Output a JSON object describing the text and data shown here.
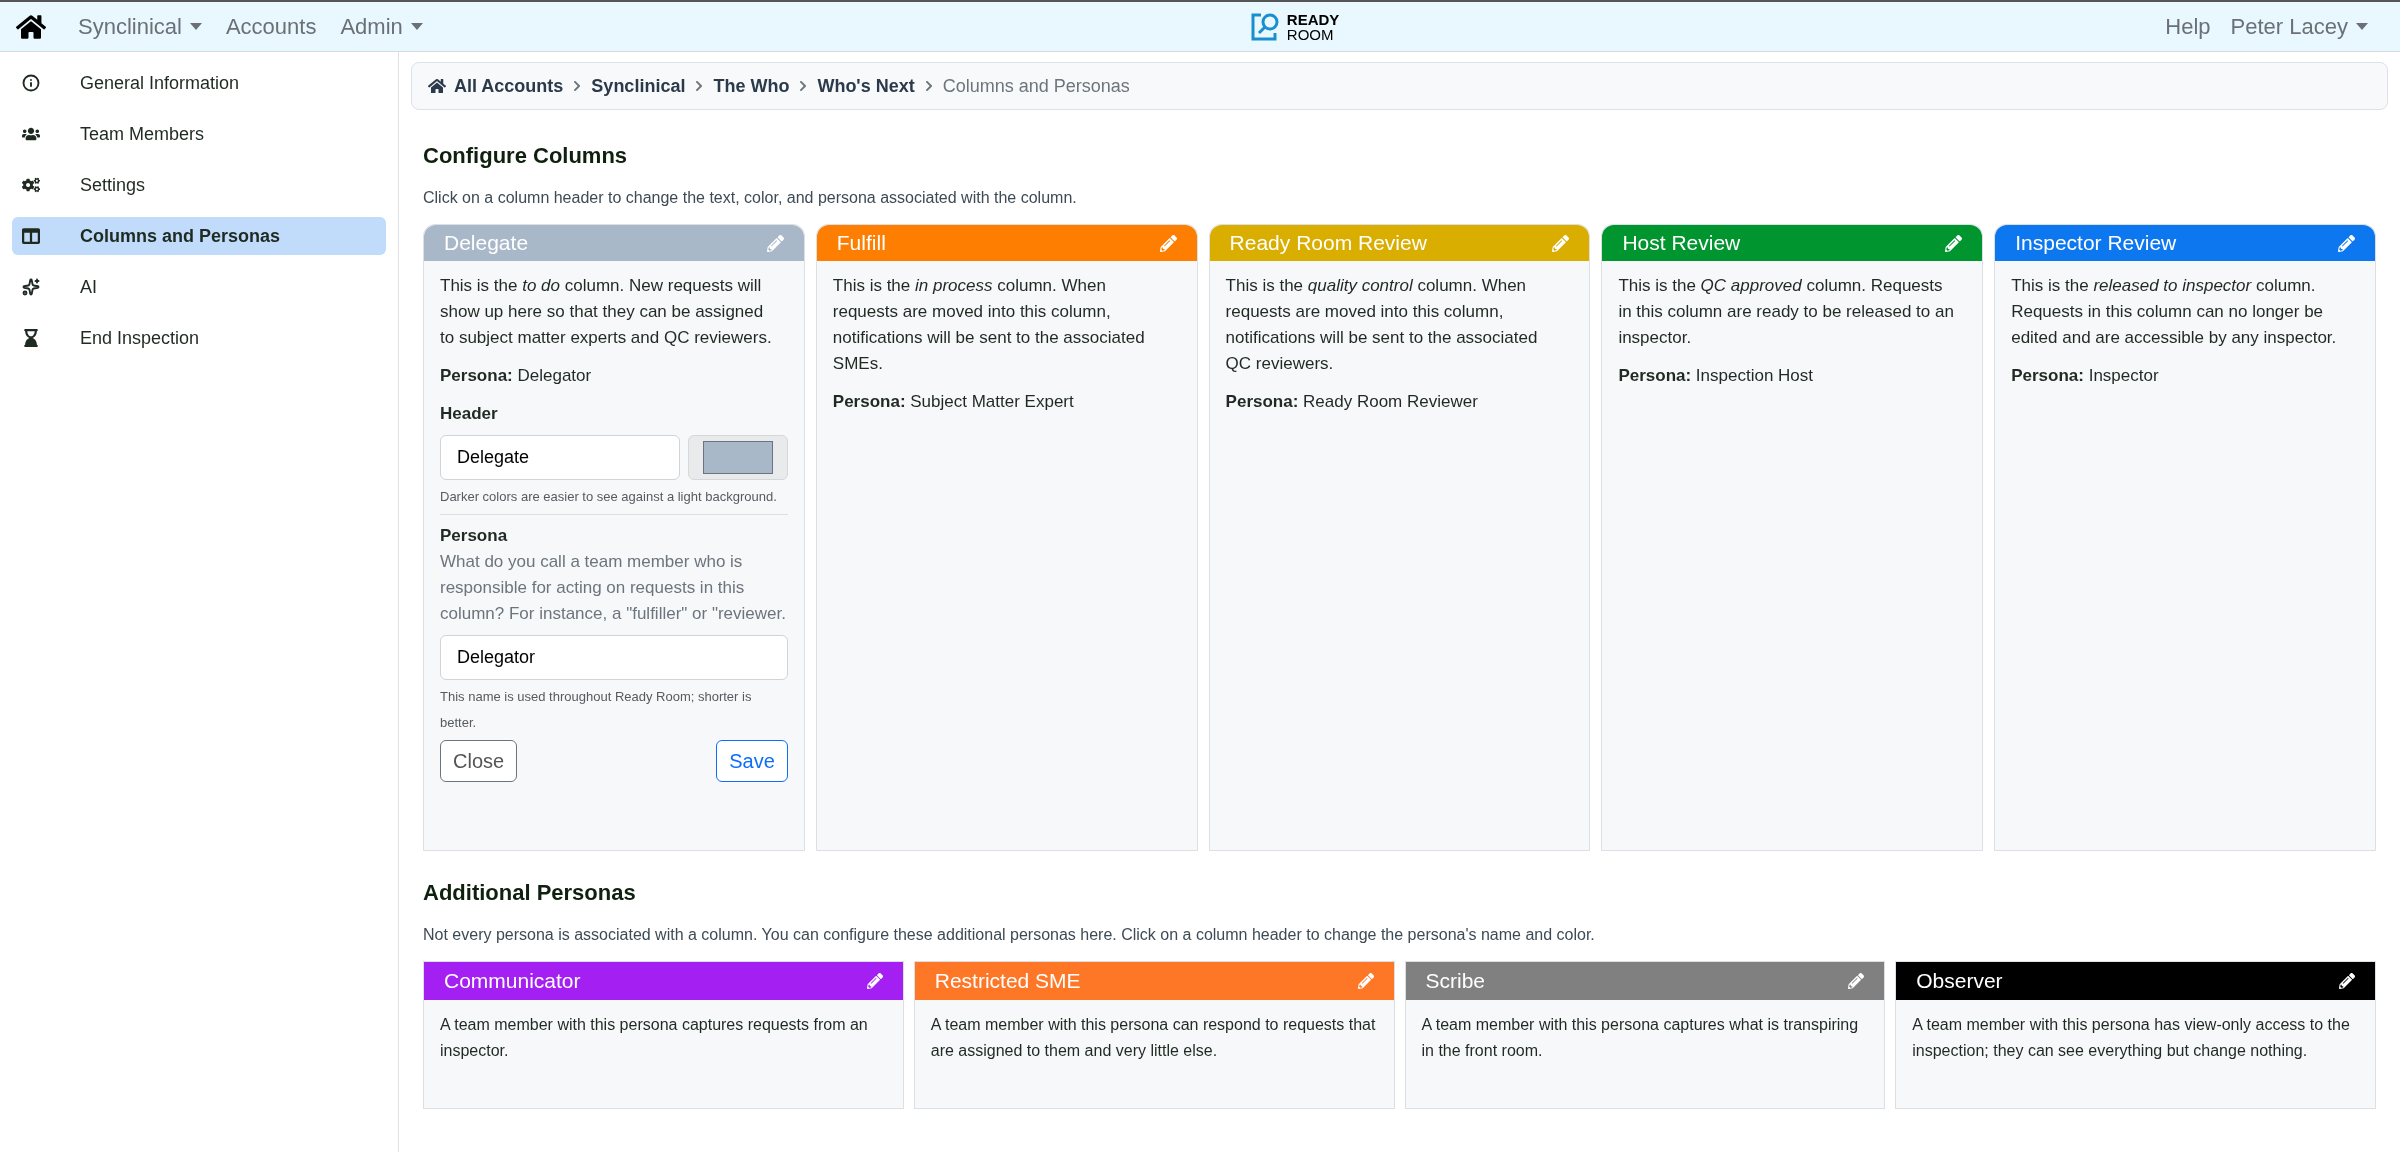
{
  "navbar": {
    "menus": [
      {
        "label": "Synclinical",
        "kind": "dropdown"
      },
      {
        "label": "Accounts",
        "kind": "link"
      },
      {
        "label": "Admin",
        "kind": "dropdown"
      }
    ],
    "logo": {
      "line_1": "READY",
      "line_2": "ROOM"
    },
    "right": [
      {
        "label": "Help",
        "kind": "link"
      },
      {
        "label": "Peter Lacey",
        "kind": "dropdown"
      }
    ]
  },
  "sidebar": {
    "items": [
      {
        "label": "General Information",
        "selected": false
      },
      {
        "label": "Team Members",
        "selected": false
      },
      {
        "label": "Settings",
        "selected": false
      },
      {
        "label": "Columns and Personas",
        "selected": true
      },
      {
        "label": "AI",
        "selected": false
      },
      {
        "label": "End Inspection",
        "selected": false
      }
    ]
  },
  "breadcrumb": [
    {
      "label": "All Accounts",
      "current": false
    },
    {
      "label": "Synclinical",
      "current": false
    },
    {
      "label": "The Who",
      "current": false
    },
    {
      "label": "Who's Next",
      "current": false
    },
    {
      "label": "Columns and Personas",
      "current": true
    }
  ],
  "configure_columns": {
    "title": "Configure Columns",
    "intro": "Click on a column header to change the text, color, and persona associated with the column.",
    "columns": [
      {
        "header": "Delegate",
        "color": "#a9b8c9",
        "description": "This is the *to do* column. New requests will show up here so that they can be assigned to subject matter experts and QC reviewers.",
        "persona": "**Persona:** Delegator",
        "editor": {
          "header_label": "Header",
          "header_value": "Delegate",
          "color": "#a9b8c9",
          "color_hint": "Darker colors are easier to see against a light background.",
          "persona_label": "Persona",
          "persona_help": "What do you call a team member who is responsible for acting on requests in this column? For instance, a \"fulfiller\" or \"reviewer.",
          "persona_value": "Delegator",
          "persona_hint": "This name is used throughout Ready Room; shorter is better.",
          "close": "Close",
          "save": "Save"
        }
      },
      {
        "header": "Fulfill",
        "color": "#fd7e00",
        "description": "This is the *in process* column. When requests are moved into this column, notifications will be sent to the associated SMEs.",
        "persona": "**Persona:** Subject Matter Expert"
      },
      {
        "header": "Ready Room Review",
        "color": "#d9ae00",
        "description": "This is the *quality control* column. When requests are moved into this column, notifications will be sent to the associated QC reviewers.",
        "persona": "**Persona:** Ready Room Reviewer"
      },
      {
        "header": "Host Review",
        "color": "#00952f",
        "description": "This is the *QC approved* column. Requests in this column are ready to be released to an inspector.",
        "persona": "**Persona:** Inspection Host"
      },
      {
        "header": "Inspector Review",
        "color": "#0d77f0",
        "description": "This is the *released to inspector* column. Requests in this column can no longer be edited and are accessible by any inspector.",
        "persona": "**Persona:** Inspector"
      }
    ]
  },
  "additional_personas": {
    "title": "Additional Personas",
    "intro": "Not every persona is associated with a column. You can configure these additional personas here. Click on a column header to change the persona's name and color.",
    "personas": [
      {
        "name": "Communicator",
        "color": "#a31ff2",
        "description": "A team member with this persona captures requests from an inspector."
      },
      {
        "name": "Restricted SME",
        "color": "#fd7726",
        "description": "A team member with this persona can respond to requests that are assigned to them and very little else."
      },
      {
        "name": "Scribe",
        "color": "#808080",
        "description": "A team member with this persona captures what is transpiring in the front room."
      },
      {
        "name": "Observer",
        "color": "#000000",
        "description": "A team member with this persona has view-only access to the inspection; they can see everything but change nothing."
      }
    ]
  }
}
